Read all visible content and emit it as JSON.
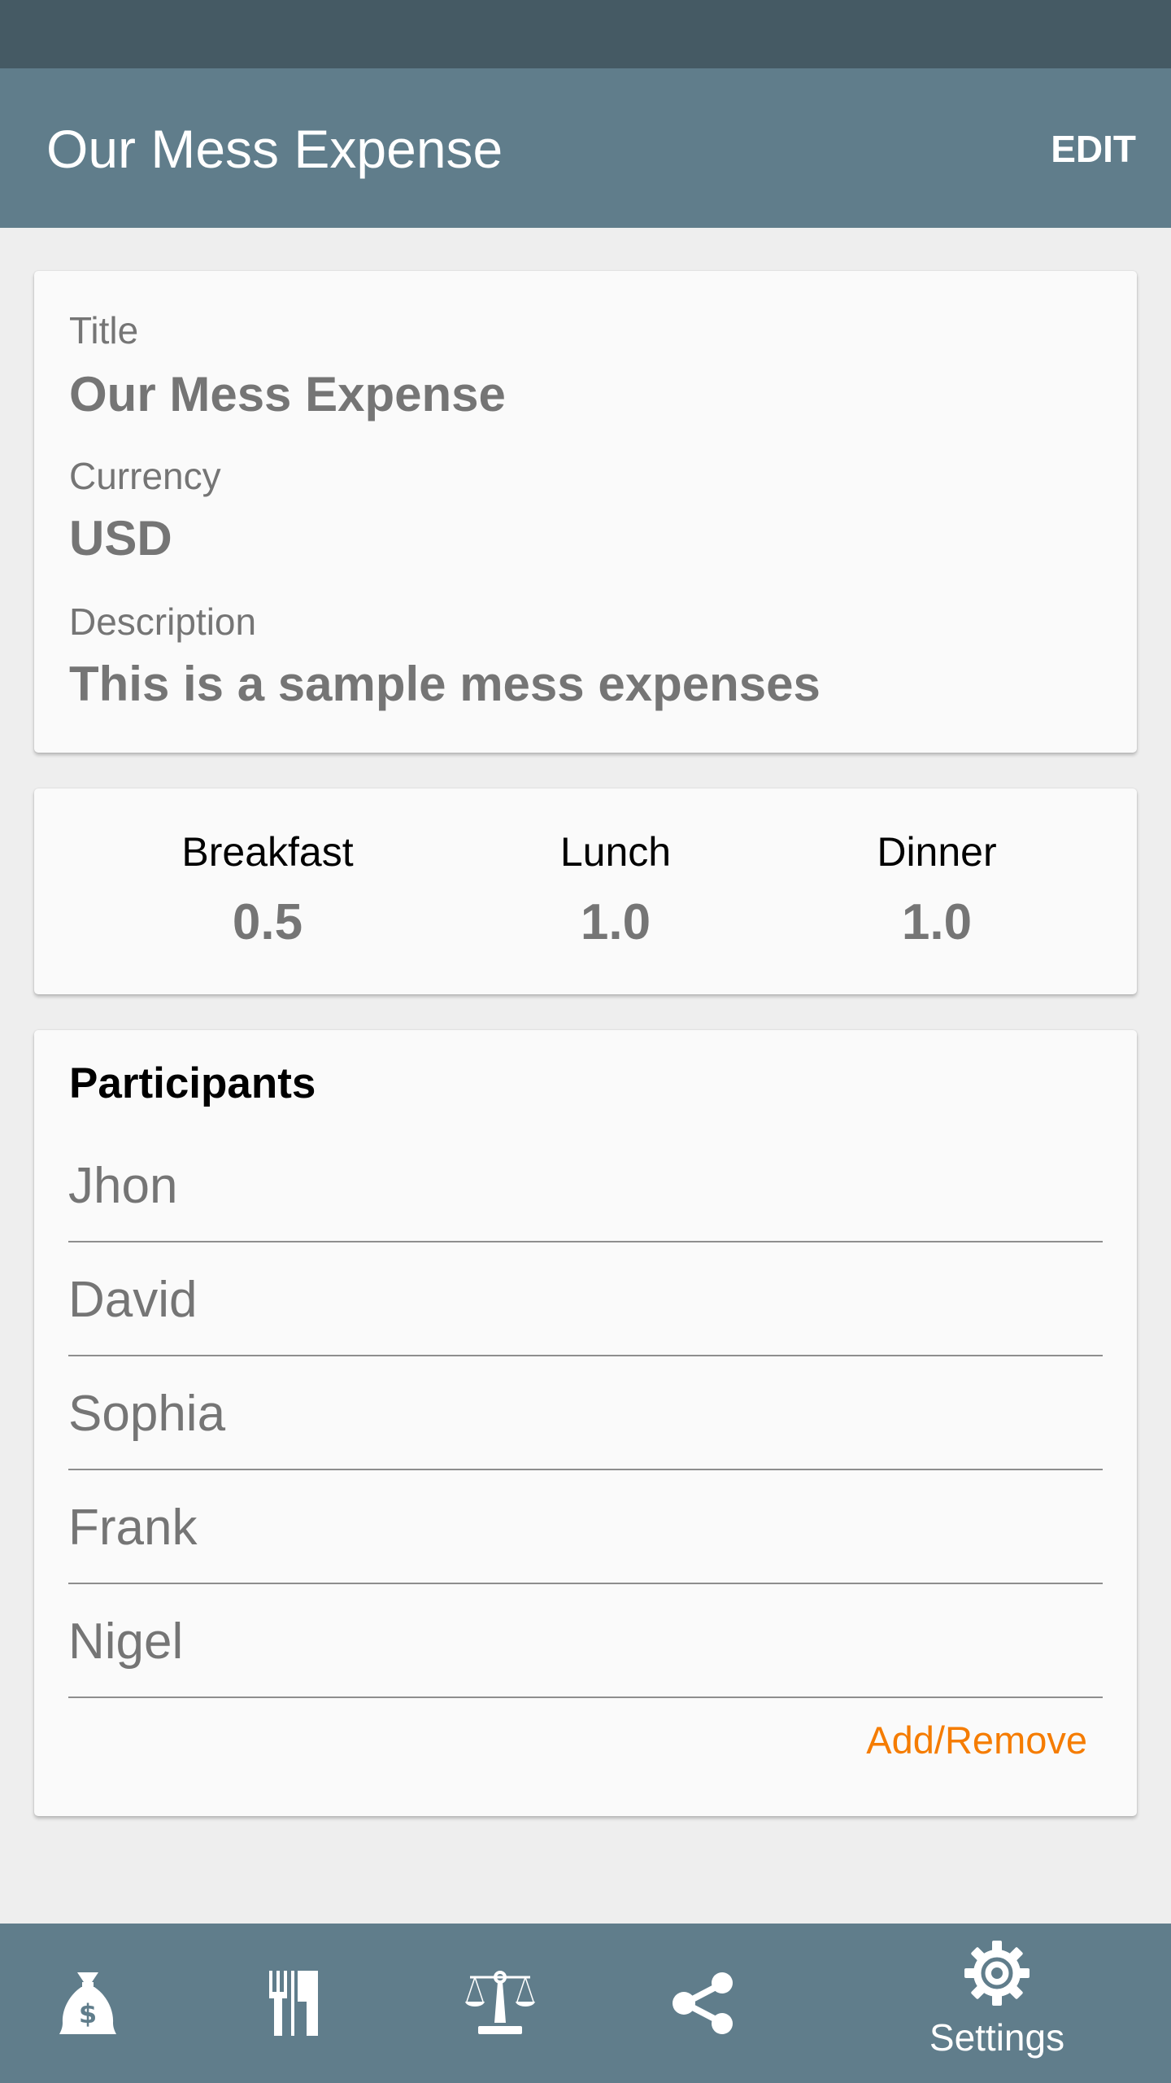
{
  "app_bar": {
    "title": "Our Mess Expense",
    "edit_label": "EDIT"
  },
  "info": {
    "title_label": "Title",
    "title_value": "Our Mess Expense",
    "currency_label": "Currency",
    "currency_value": "USD",
    "description_label": "Description",
    "description_value": "This is a sample mess expenses"
  },
  "meals": [
    {
      "name": "Breakfast",
      "value": "0.5"
    },
    {
      "name": "Lunch",
      "value": "1.0"
    },
    {
      "name": "Dinner",
      "value": "1.0"
    }
  ],
  "participants": {
    "heading": "Participants",
    "names": [
      "Jhon",
      "David",
      "Sophia",
      "Frank",
      "Nigel"
    ],
    "add_remove_label": "Add/Remove"
  },
  "bottom_nav": {
    "items": [
      {
        "icon": "money-bag-icon",
        "label": ""
      },
      {
        "icon": "cutlery-icon",
        "label": ""
      },
      {
        "icon": "balance-scale-icon",
        "label": ""
      },
      {
        "icon": "share-icon",
        "label": ""
      },
      {
        "icon": "gear-icon",
        "label": "Settings"
      }
    ],
    "active_index": 4
  },
  "colors": {
    "status_bar": "#455a64",
    "primary": "#607d8b",
    "accent": "#f57c00",
    "background": "#eeeeee",
    "card": "#fafafa"
  }
}
